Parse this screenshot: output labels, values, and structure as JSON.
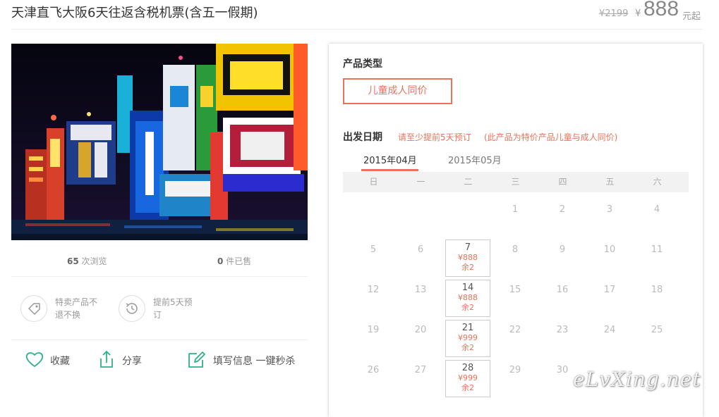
{
  "header": {
    "title": "天津直飞大阪6天往返含税机票(含五一假期)",
    "original_price": "¥2199",
    "currency_symbol": "¥",
    "current_price": "888",
    "price_suffix": "元起"
  },
  "stats": {
    "views_count": "65",
    "views_label": "次浏览",
    "sold_count": "0",
    "sold_label": "件已售"
  },
  "features": [
    {
      "icon": "tag-icon",
      "text": "特卖产品不退不换"
    },
    {
      "icon": "clock-history-icon",
      "text": "提前5天预订"
    }
  ],
  "actions": {
    "favorite": "收藏",
    "share": "分享",
    "book": "填写信息 一键秒杀"
  },
  "product_type": {
    "label": "产品类型",
    "option": "儿童成人同价"
  },
  "departure": {
    "label": "出发日期",
    "note1": "请至少提前5天预订",
    "note2": "(此产品为特价产品儿童与成人同价)",
    "months": [
      "2015年04月",
      "2015年05月"
    ],
    "selected_month": 0,
    "weekdays": [
      "日",
      "一",
      "二",
      "三",
      "四",
      "五",
      "六"
    ],
    "weeks": [
      [
        null,
        null,
        null,
        {
          "d": "1"
        },
        {
          "d": "2"
        },
        {
          "d": "3"
        },
        {
          "d": "4"
        }
      ],
      [
        {
          "d": "5"
        },
        {
          "d": "6"
        },
        {
          "d": "7",
          "price": "¥888",
          "stock": "余2"
        },
        {
          "d": "8"
        },
        {
          "d": "9"
        },
        {
          "d": "10"
        },
        {
          "d": "11"
        }
      ],
      [
        {
          "d": "12"
        },
        {
          "d": "13"
        },
        {
          "d": "14",
          "price": "¥888",
          "stock": "余2"
        },
        {
          "d": "15"
        },
        {
          "d": "16"
        },
        {
          "d": "17"
        },
        {
          "d": "18"
        }
      ],
      [
        {
          "d": "19"
        },
        {
          "d": "20"
        },
        {
          "d": "21",
          "price": "¥999",
          "stock": "余2"
        },
        {
          "d": "22"
        },
        {
          "d": "23"
        },
        {
          "d": "24"
        },
        {
          "d": "25"
        }
      ],
      [
        {
          "d": "26"
        },
        {
          "d": "27"
        },
        {
          "d": "28",
          "price": "¥999",
          "stock": "余2"
        },
        {
          "d": "29"
        },
        {
          "d": "30"
        },
        null,
        null
      ]
    ]
  },
  "watermark": "eLvXing.net",
  "colors": {
    "accent": "#e8735a",
    "icon_green": "#2bb28b"
  }
}
